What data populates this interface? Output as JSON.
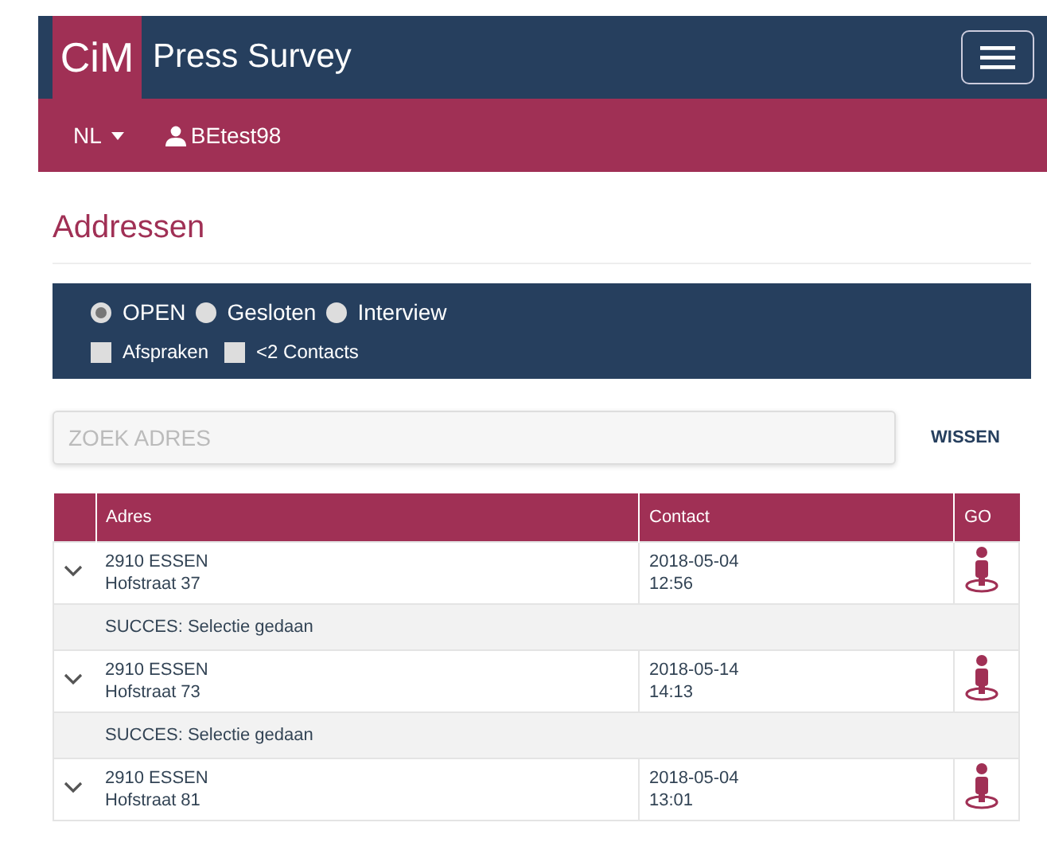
{
  "navbar": {
    "logo": "CiM",
    "title": "Press Survey"
  },
  "subbar": {
    "language": "NL",
    "user": "BEtest98"
  },
  "page_title": "Addressen",
  "filters": {
    "radios": [
      {
        "label": "OPEN",
        "selected": true
      },
      {
        "label": "Gesloten",
        "selected": false
      },
      {
        "label": "Interview",
        "selected": false
      }
    ],
    "checkboxes": [
      {
        "label": "Afspraken",
        "checked": false
      },
      {
        "label": "<2 Contacts",
        "checked": false
      }
    ]
  },
  "search": {
    "placeholder": "ZOEK ADRES",
    "clear_button": "WISSEN"
  },
  "table": {
    "columns": [
      "Adres",
      "Contact",
      "GO"
    ],
    "rows": [
      {
        "city": "2910 ESSEN",
        "street": "Hofstraat 37",
        "date": "2018-05-04",
        "time": "12:56",
        "status": "SUCCES: Selectie gedaan"
      },
      {
        "city": "2910 ESSEN",
        "street": "Hofstraat 73",
        "date": "2018-05-14",
        "time": "14:13",
        "status": "SUCCES: Selectie gedaan"
      },
      {
        "city": "2910 ESSEN",
        "street": "Hofstraat 81",
        "date": "2018-05-04",
        "time": "13:01"
      }
    ]
  }
}
